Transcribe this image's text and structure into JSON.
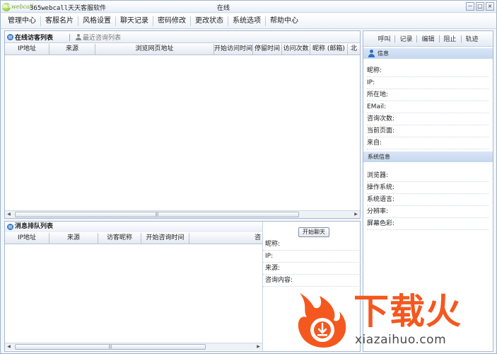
{
  "window": {
    "logo_text": "webcall",
    "title": "365webcall天天客服软件",
    "status": "在线",
    "controls": [
      "－",
      "□",
      "×"
    ]
  },
  "menu": [
    "管理中心",
    "客服名片",
    "风格设置",
    "聊天记录",
    "密码修改",
    "更改状态",
    "系统选项",
    "帮助中心"
  ],
  "visitor_panel": {
    "tab_online": "在线访客列表",
    "tab_recent": "最近咨询列表",
    "columns": [
      "IP地址",
      "来源",
      "浏览网页地址",
      "开始访问时间",
      "停留时间",
      "访问次数",
      "昵称 (邮箱)",
      "北"
    ]
  },
  "queue_panel": {
    "title": "消息排队列表",
    "columns": [
      "IP地址",
      "来源",
      "访客昵称",
      "开始咨询时间",
      "咨"
    ],
    "start_chat": "开始聊天",
    "fields": [
      "昵称:",
      " IP:",
      "来源:",
      "咨询内容:"
    ]
  },
  "right_panel": {
    "toolbar": [
      "呼叫",
      "记录",
      "编辑",
      "阻止",
      "轨迹"
    ],
    "info_title": "信息",
    "info_fields": [
      "昵称:",
      " IP:",
      "所在地:",
      " EMail:",
      "咨询次数:",
      "当前页面:",
      "来自:"
    ],
    "sys_title": "系统信息",
    "sys_fields": [
      "浏览器:",
      "操作系统:",
      "系统语言:",
      "分辨率:",
      "屏幕色彩:"
    ]
  },
  "watermark": {
    "brand": "下载火",
    "domain": "xiazaihuo.com"
  },
  "colors": {
    "accent": "#3b78c4",
    "watermark": "#f4581f"
  }
}
